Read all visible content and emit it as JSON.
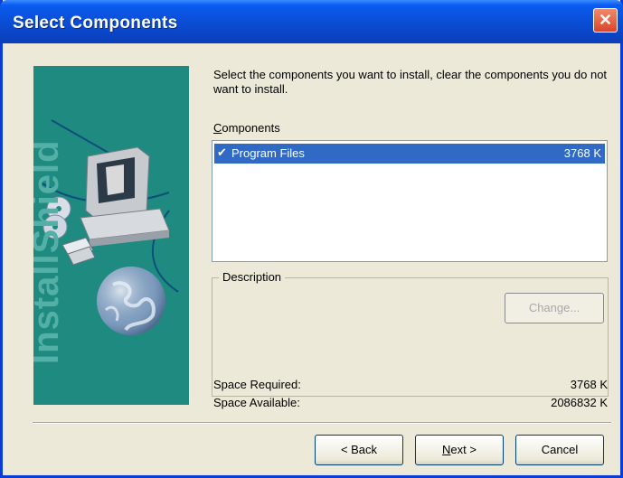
{
  "window": {
    "title": "Select Components"
  },
  "banner": {
    "text": "InstallShield"
  },
  "intro": "Select the components you want to install, clear the components you do not want to install.",
  "components": {
    "label": "Components",
    "items": [
      {
        "name": "Program Files",
        "size": "3768 K",
        "checked": true,
        "selected": true
      }
    ]
  },
  "description": {
    "legend": "Description",
    "change_label": "Change..."
  },
  "space": {
    "required_label": "Space Required:",
    "required_value": "3768 K",
    "available_label": "Space Available:",
    "available_value": "2086832 K"
  },
  "buttons": {
    "back": "< Back",
    "next": "Next >",
    "cancel": "Cancel"
  },
  "colors": {
    "title_bar": "#0a46c8",
    "selection": "#316ac5",
    "banner": "#1e8a80",
    "dialog_bg": "#ece9d8"
  },
  "icons": [
    "close-icon",
    "computer-icon",
    "cd-icon",
    "floppy-icon",
    "globe-icon",
    "checkmark-icon"
  ]
}
